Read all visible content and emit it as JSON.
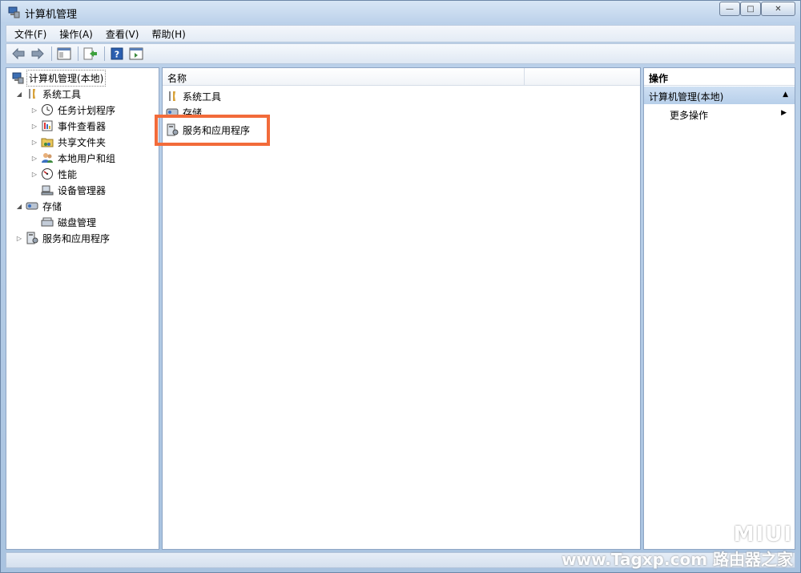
{
  "window": {
    "title": "计算机管理",
    "controls": {
      "minimize": "—",
      "maximize": "□",
      "close": "✕"
    }
  },
  "menubar": {
    "items": [
      "文件(F)",
      "操作(A)",
      "查看(V)",
      "帮助(H)"
    ]
  },
  "toolbar": {
    "buttons": [
      "back-arrow-icon",
      "forward-arrow-icon",
      "show-hide-tree-icon",
      "export-list-icon",
      "help-icon",
      "show-hide-action-pane-icon"
    ]
  },
  "tree": {
    "root": "计算机管理(本地)",
    "items": [
      {
        "label": "系统工具",
        "expander": "◢",
        "icon": "tools-icon"
      },
      {
        "label": "任务计划程序",
        "expander": "▷",
        "icon": "clock-icon"
      },
      {
        "label": "事件查看器",
        "expander": "▷",
        "icon": "event-viewer-icon"
      },
      {
        "label": "共享文件夹",
        "expander": "▷",
        "icon": "shared-folder-icon"
      },
      {
        "label": "本地用户和组",
        "expander": "▷",
        "icon": "users-icon"
      },
      {
        "label": "性能",
        "expander": "▷",
        "icon": "performance-icon"
      },
      {
        "label": "设备管理器",
        "expander": "",
        "icon": "device-manager-icon"
      },
      {
        "label": "存储",
        "expander": "◢",
        "icon": "storage-icon"
      },
      {
        "label": "磁盘管理",
        "expander": "",
        "icon": "disk-icon"
      },
      {
        "label": "服务和应用程序",
        "expander": "▷",
        "icon": "services-icon"
      }
    ]
  },
  "list": {
    "column_name": "名称",
    "rows": [
      "系统工具",
      "存储",
      "服务和应用程序"
    ]
  },
  "actions": {
    "title": "操作",
    "section": "计算机管理(本地)",
    "section_arrow": "▲",
    "more": "更多操作",
    "more_arrow": "▶"
  },
  "watermark": {
    "top": "MIUI",
    "bottom": "www.Tagxp.com 路由器之家"
  },
  "colors": {
    "highlight": "#f26b3a",
    "window_frame": "#bcd2ea"
  }
}
